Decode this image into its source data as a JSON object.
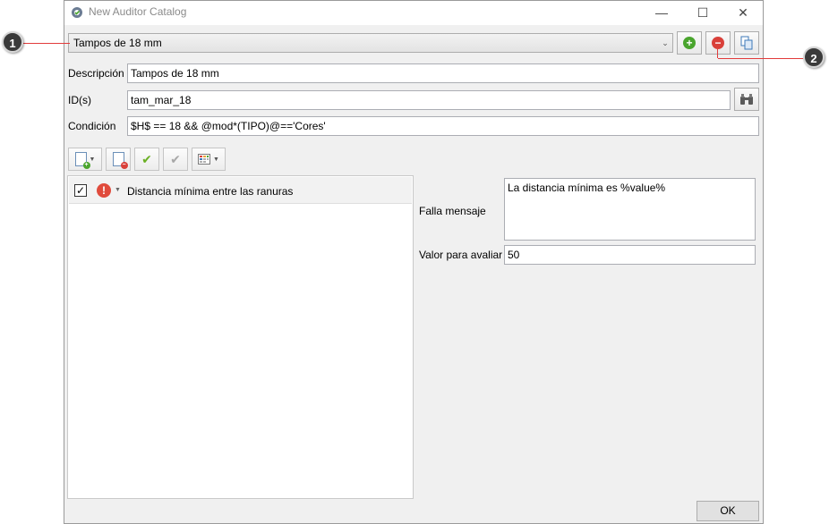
{
  "window": {
    "title": "New Auditor Catalog",
    "controls": {
      "minimize": "—",
      "maximize": "☐",
      "close": "✕"
    }
  },
  "catalog": {
    "selected": "Tampos de 18 mm",
    "add_icon": "plus-circle-icon",
    "remove_icon": "minus-circle-icon",
    "copy_icon": "copy-icon"
  },
  "form": {
    "description_label": "Descripción",
    "description_value": "Tampos de 18 mm",
    "ids_label": "ID(s)",
    "ids_value": "tam_mar_18",
    "condition_label": "Condición",
    "condition_value": "$H$ == 18 && @mod*(TIPO)@=='Cores'",
    "search_icon": "binoculars-icon"
  },
  "rules": {
    "items": [
      {
        "checked": true,
        "severity": "error",
        "label": "Distancia mínima entre las ranuras"
      }
    ]
  },
  "detail": {
    "fail_message_label": "Falla mensaje",
    "fail_message_value": "La distancia mínima es %value%",
    "eval_value_label": "Valor para avaliar",
    "eval_value": "50"
  },
  "ok_label": "OK",
  "callouts": [
    "1",
    "2"
  ],
  "colors": {
    "callout_line": "#e23b3b",
    "add_green": "#4aa52e",
    "remove_red": "#d9403a",
    "check_green": "#6ab023"
  }
}
